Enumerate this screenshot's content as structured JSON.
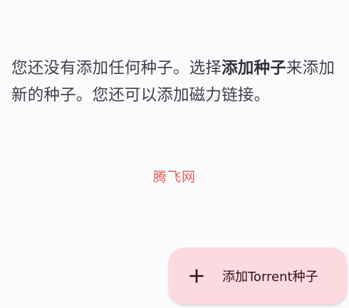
{
  "empty_state": {
    "message_before": "您还没有添加任何种子。选择",
    "message_bold": "添加种子",
    "message_after": "来添加新的种子。您还可以添加磁力链接。"
  },
  "watermark": {
    "text": "腾飞网",
    "color": "#e2615f"
  },
  "fab": {
    "icon": "plus-icon",
    "label": "添加Torrent种子",
    "background": "#fdd9e0"
  }
}
